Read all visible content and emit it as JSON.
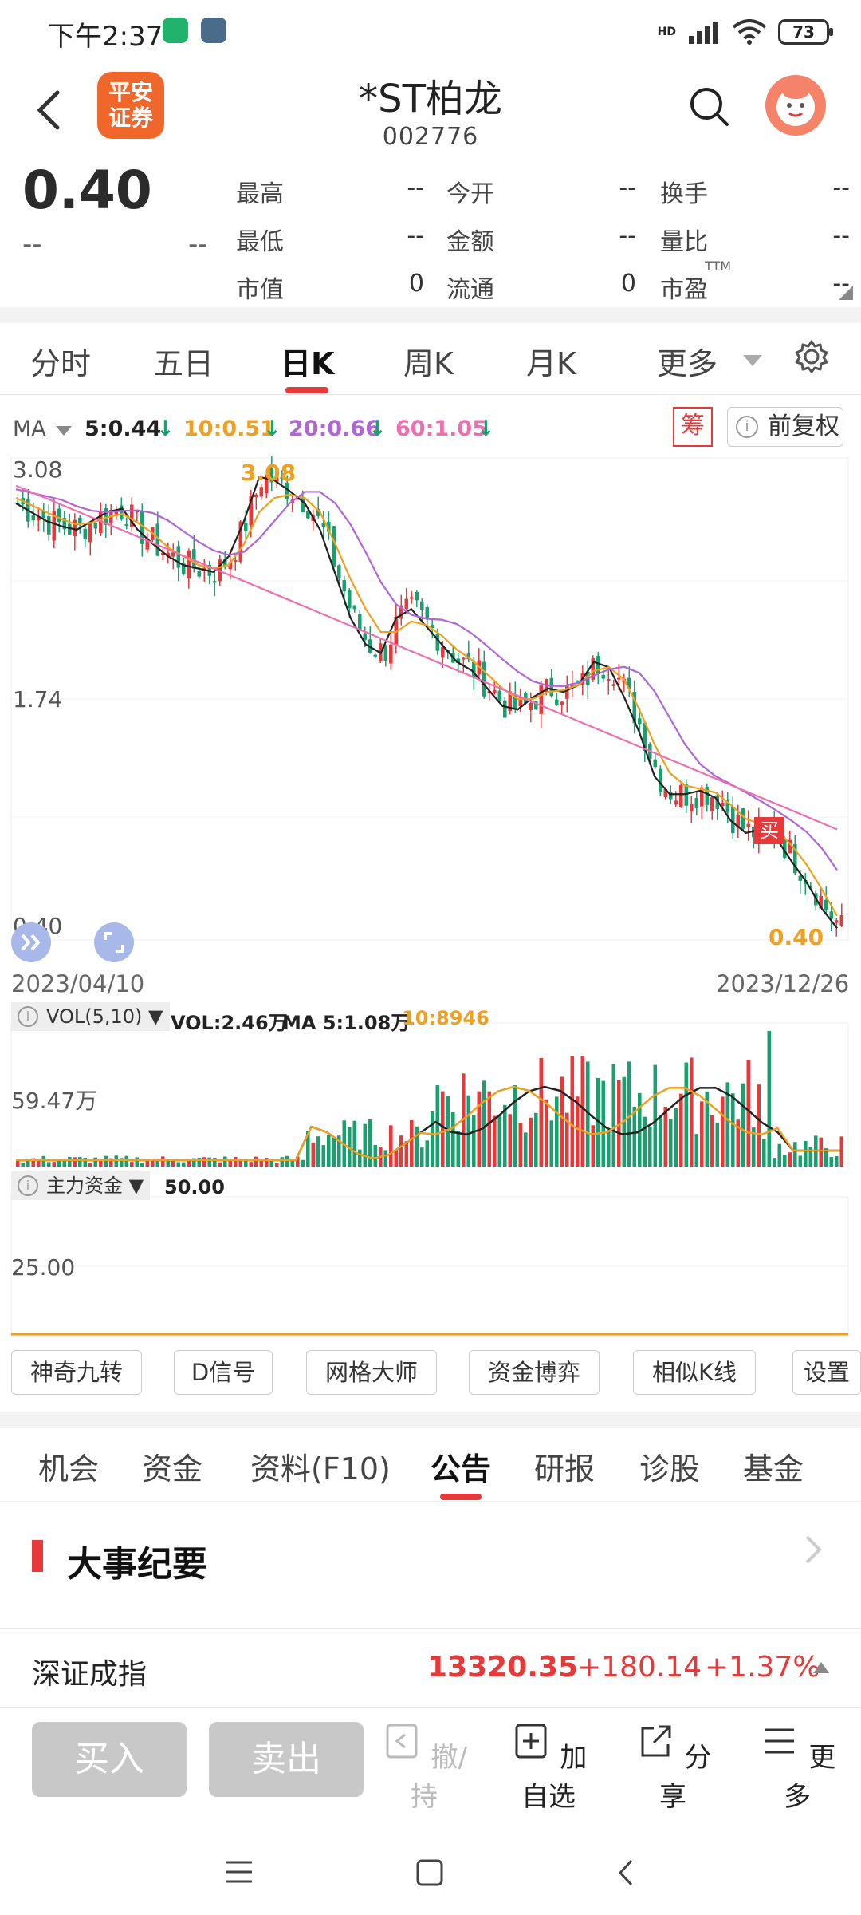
{
  "status_bar": {
    "time": "下午2:37",
    "battery": "73",
    "network": "HD"
  },
  "header": {
    "logo": "平安证券",
    "stock_name": "*ST柏龙",
    "stock_code": "002776"
  },
  "quote": {
    "price": "0.40",
    "change": "--",
    "change_pct": "--",
    "stats": [
      {
        "label": "最高",
        "value": "--"
      },
      {
        "label": "今开",
        "value": "--"
      },
      {
        "label": "换手",
        "value": "--"
      },
      {
        "label": "最低",
        "value": "--"
      },
      {
        "label": "金额",
        "value": "--"
      },
      {
        "label": "量比",
        "value": "--"
      },
      {
        "label": "市值",
        "value": "0"
      },
      {
        "label": "流通",
        "value": "0"
      },
      {
        "label": "市盈",
        "value": "--",
        "sup": "TTM"
      }
    ]
  },
  "chart_tabs": [
    "分时",
    "五日",
    "日K",
    "周K",
    "月K",
    "更多"
  ],
  "active_chart_tab": "日K",
  "ma_legend": {
    "label": "MA",
    "ma5": "5:0.44",
    "ma10": "10:0.51",
    "ma20": "20:0.66",
    "ma60": "60:1.05"
  },
  "chip_label": "筹",
  "fuquan_label": "前复权",
  "buy_marker": "买",
  "colors": {
    "up": "#e8393a",
    "down": "#1a9f6e",
    "ma5": "#222222",
    "ma10": "#f0a020",
    "ma20": "#b066d8",
    "ma60": "#ee6fb0",
    "mf_line": "#f0a020",
    "accent": "#e8393a"
  },
  "chart_data": [
    {
      "type": "candlestick",
      "x_start": "2023/04/10",
      "x_end": "2023/12/26",
      "ylim": [
        0.4,
        3.08
      ],
      "y_ticks": [
        "3.08",
        "1.74",
        "0.40"
      ],
      "high_label": "3.08",
      "low_label": "0.40",
      "series": [
        {
          "name": "5:0.44",
          "values": [
            2.85,
            2.8,
            2.75,
            2.72,
            2.7,
            2.75,
            2.8,
            2.82,
            2.7,
            2.62,
            2.55,
            2.5,
            2.48,
            2.46,
            2.55,
            2.75,
            3.0,
            2.98,
            2.92,
            2.85,
            2.7,
            2.45,
            2.2,
            2.05,
            2.0,
            2.2,
            2.25,
            2.15,
            2.05,
            1.95,
            1.9,
            1.8,
            1.7,
            1.68,
            1.75,
            1.8,
            1.78,
            1.82,
            1.95,
            1.92,
            1.75,
            1.55,
            1.3,
            1.2,
            1.2,
            1.22,
            1.18,
            1.05,
            0.98,
            1.0,
            0.95,
            0.82,
            0.7,
            0.55,
            0.44
          ]
        },
        {
          "name": "10:0.51",
          "values": [
            2.88,
            2.84,
            2.8,
            2.76,
            2.73,
            2.74,
            2.77,
            2.79,
            2.74,
            2.68,
            2.6,
            2.55,
            2.5,
            2.48,
            2.5,
            2.62,
            2.8,
            2.88,
            2.9,
            2.88,
            2.8,
            2.62,
            2.42,
            2.25,
            2.12,
            2.12,
            2.18,
            2.16,
            2.1,
            2.02,
            1.96,
            1.88,
            1.8,
            1.74,
            1.74,
            1.78,
            1.79,
            1.82,
            1.9,
            1.92,
            1.85,
            1.68,
            1.48,
            1.32,
            1.25,
            1.23,
            1.21,
            1.14,
            1.06,
            1.03,
            1.0,
            0.91,
            0.8,
            0.66,
            0.51
          ]
        }
      ]
    },
    {
      "type": "bar",
      "title": "VOL(5,10)",
      "values_text": "VOL:2.46万",
      "ma5_text": "MA 5:1.08万",
      "ma10_text": "10:8946",
      "y_tick": "59.47万"
    },
    {
      "type": "line",
      "title": "主力资金",
      "top_value": "50.00",
      "y_tick": "25.00"
    }
  ],
  "tools": [
    "神奇九转",
    "D信号",
    "网格大师",
    "资金博弈",
    "相似K线",
    "设置"
  ],
  "info_tabs": [
    "机会",
    "资金",
    "资料(F10)",
    "公告",
    "研报",
    "诊股",
    "基金"
  ],
  "active_info_tab": "公告",
  "section": {
    "title": "大事纪要"
  },
  "index": {
    "name": "深证成指",
    "value": "13320.35",
    "change": "+180.14",
    "change_pct": "+1.37%"
  },
  "actions": {
    "buy": "买入",
    "sell": "卖出",
    "withdraw": "撤/持",
    "add_watch": "加自选",
    "share": "分享",
    "more": "更多"
  }
}
